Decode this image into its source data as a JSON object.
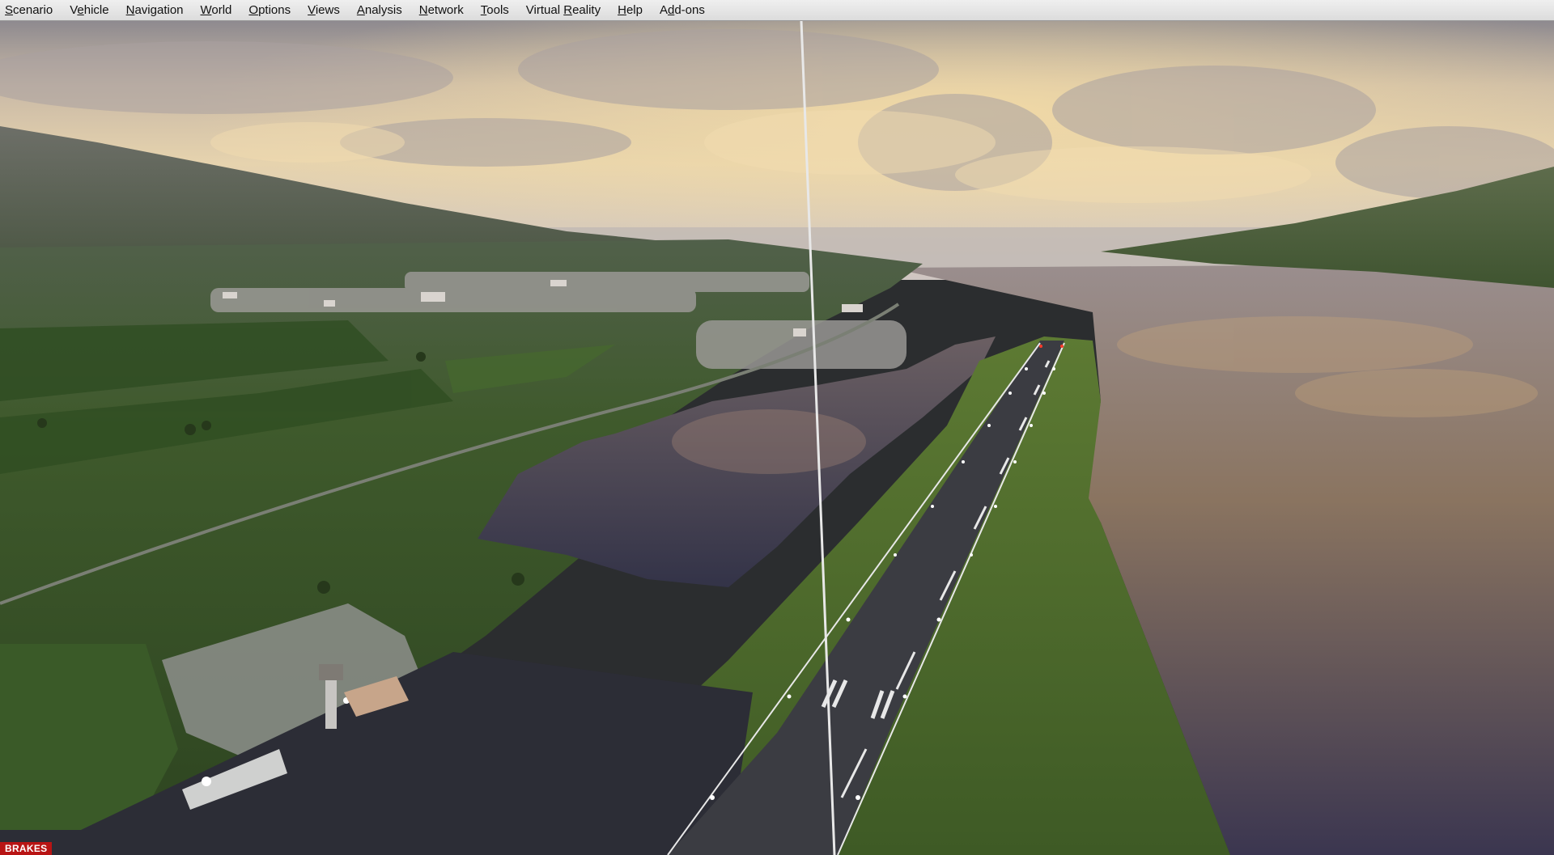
{
  "menu": {
    "items": [
      {
        "name": "scenario",
        "pre": "",
        "u": "S",
        "post": "cenario"
      },
      {
        "name": "vehicle",
        "pre": "V",
        "u": "e",
        "post": "hicle"
      },
      {
        "name": "navigation",
        "pre": "",
        "u": "N",
        "post": "avigation"
      },
      {
        "name": "world",
        "pre": "",
        "u": "W",
        "post": "orld"
      },
      {
        "name": "options",
        "pre": "",
        "u": "O",
        "post": "ptions"
      },
      {
        "name": "views",
        "pre": "",
        "u": "V",
        "post": "iews"
      },
      {
        "name": "analysis",
        "pre": "",
        "u": "A",
        "post": "nalysis"
      },
      {
        "name": "network",
        "pre": "",
        "u": "N",
        "post": "etwork"
      },
      {
        "name": "tools",
        "pre": "",
        "u": "T",
        "post": "ools"
      },
      {
        "name": "virtual-reality",
        "pre": "Virtual ",
        "u": "R",
        "post": "eality"
      },
      {
        "name": "help",
        "pre": "",
        "u": "H",
        "post": "elp"
      },
      {
        "name": "add-ons",
        "pre": "A",
        "u": "d",
        "post": "d-ons"
      }
    ]
  },
  "status": {
    "brakes_label": "BRAKES"
  },
  "scene": {
    "description_icon": "flight-sim-3d-view",
    "colors": {
      "sky_top": "#8f8a8e",
      "sky_glow": "#e8d2a6",
      "grass": "#3d5a2a",
      "water": "#5a5058",
      "runway": "#3a3b40",
      "brakes_bg": "#b81414"
    }
  }
}
